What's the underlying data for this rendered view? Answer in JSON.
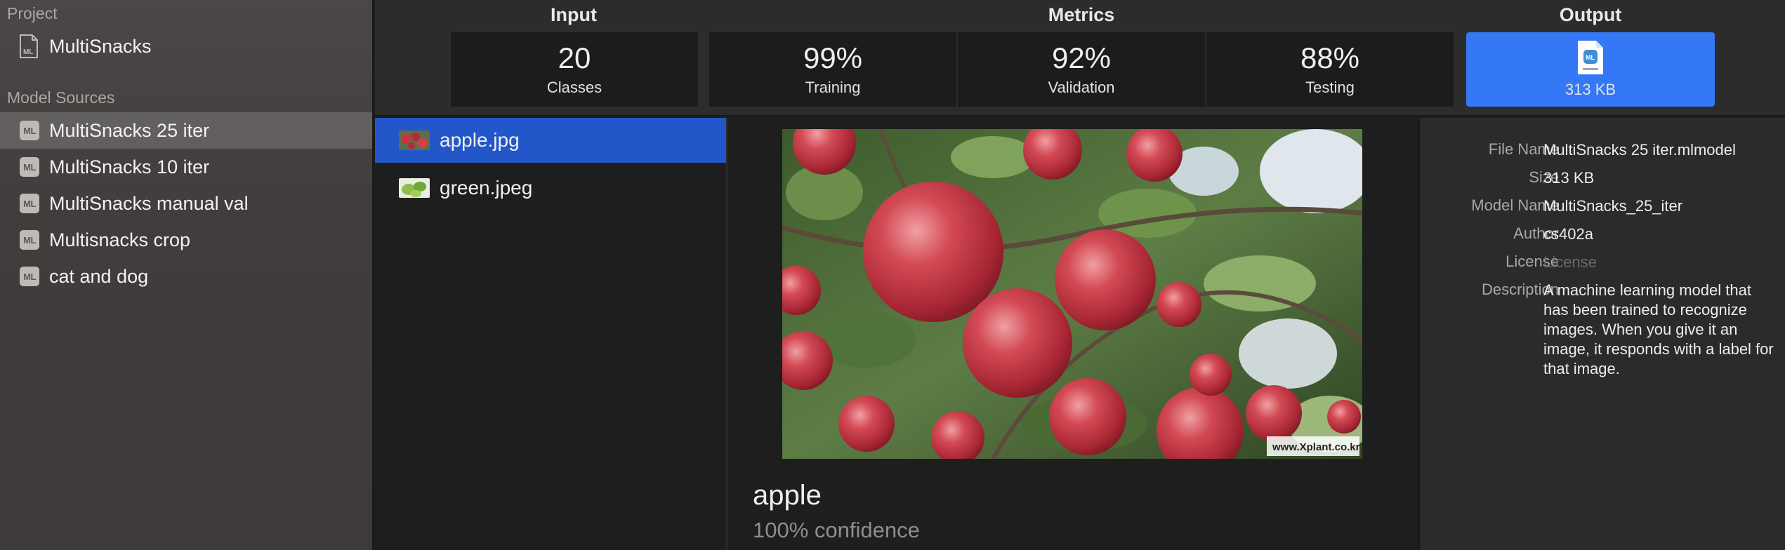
{
  "sidebar": {
    "project_title": "Project",
    "project_name": "MultiSnacks",
    "sources_title": "Model Sources",
    "items": [
      {
        "icon": "ML",
        "label": "MultiSnacks 25 iter"
      },
      {
        "icon": "ML",
        "label": "MultiSnacks 10 iter"
      },
      {
        "icon": "ML",
        "label": "MultiSnacks manual val"
      },
      {
        "icon": "ML",
        "label": "Multisnacks crop"
      },
      {
        "icon": "ML",
        "label": "cat and dog"
      }
    ],
    "selected_index": 0
  },
  "topbar": {
    "input_label": "Input",
    "metrics_label": "Metrics",
    "output_label": "Output",
    "input_tile": {
      "value": "20",
      "sub": "Classes"
    },
    "metrics": [
      {
        "value": "99%",
        "sub": "Training"
      },
      {
        "value": "92%",
        "sub": "Validation"
      },
      {
        "value": "88%",
        "sub": "Testing"
      }
    ],
    "output_tile": {
      "icon": "mlmodel-file-icon",
      "sub": "313 KB"
    }
  },
  "files": [
    {
      "name": "apple.jpg",
      "thumb": "apple-thumbnail"
    },
    {
      "name": "green.jpeg",
      "thumb": "green-thumbnail"
    }
  ],
  "selected_file": 0,
  "preview": {
    "watermark": "www.Xplant.co.kr",
    "prediction_label": "apple",
    "confidence": "100% confidence"
  },
  "details": {
    "rows": [
      {
        "key": "File Name",
        "value": "MultiSnacks 25 iter.mlmodel"
      },
      {
        "key": "Size",
        "value": "313 KB"
      },
      {
        "key": "Model Name",
        "value": "MultiSnacks_25_iter"
      },
      {
        "key": "Author",
        "value": "cs402a"
      },
      {
        "key": "License",
        "value": "License",
        "placeholder": true
      },
      {
        "key": "Description",
        "value": "A machine learning model that has been trained to recognize images. When you give it an image, it responds with a label for that image."
      }
    ]
  },
  "colors": {
    "accent": "#3478f6",
    "selection": "#2356c8",
    "apple_red": "#c9323f",
    "leaf_green": "#4c7a3a"
  }
}
